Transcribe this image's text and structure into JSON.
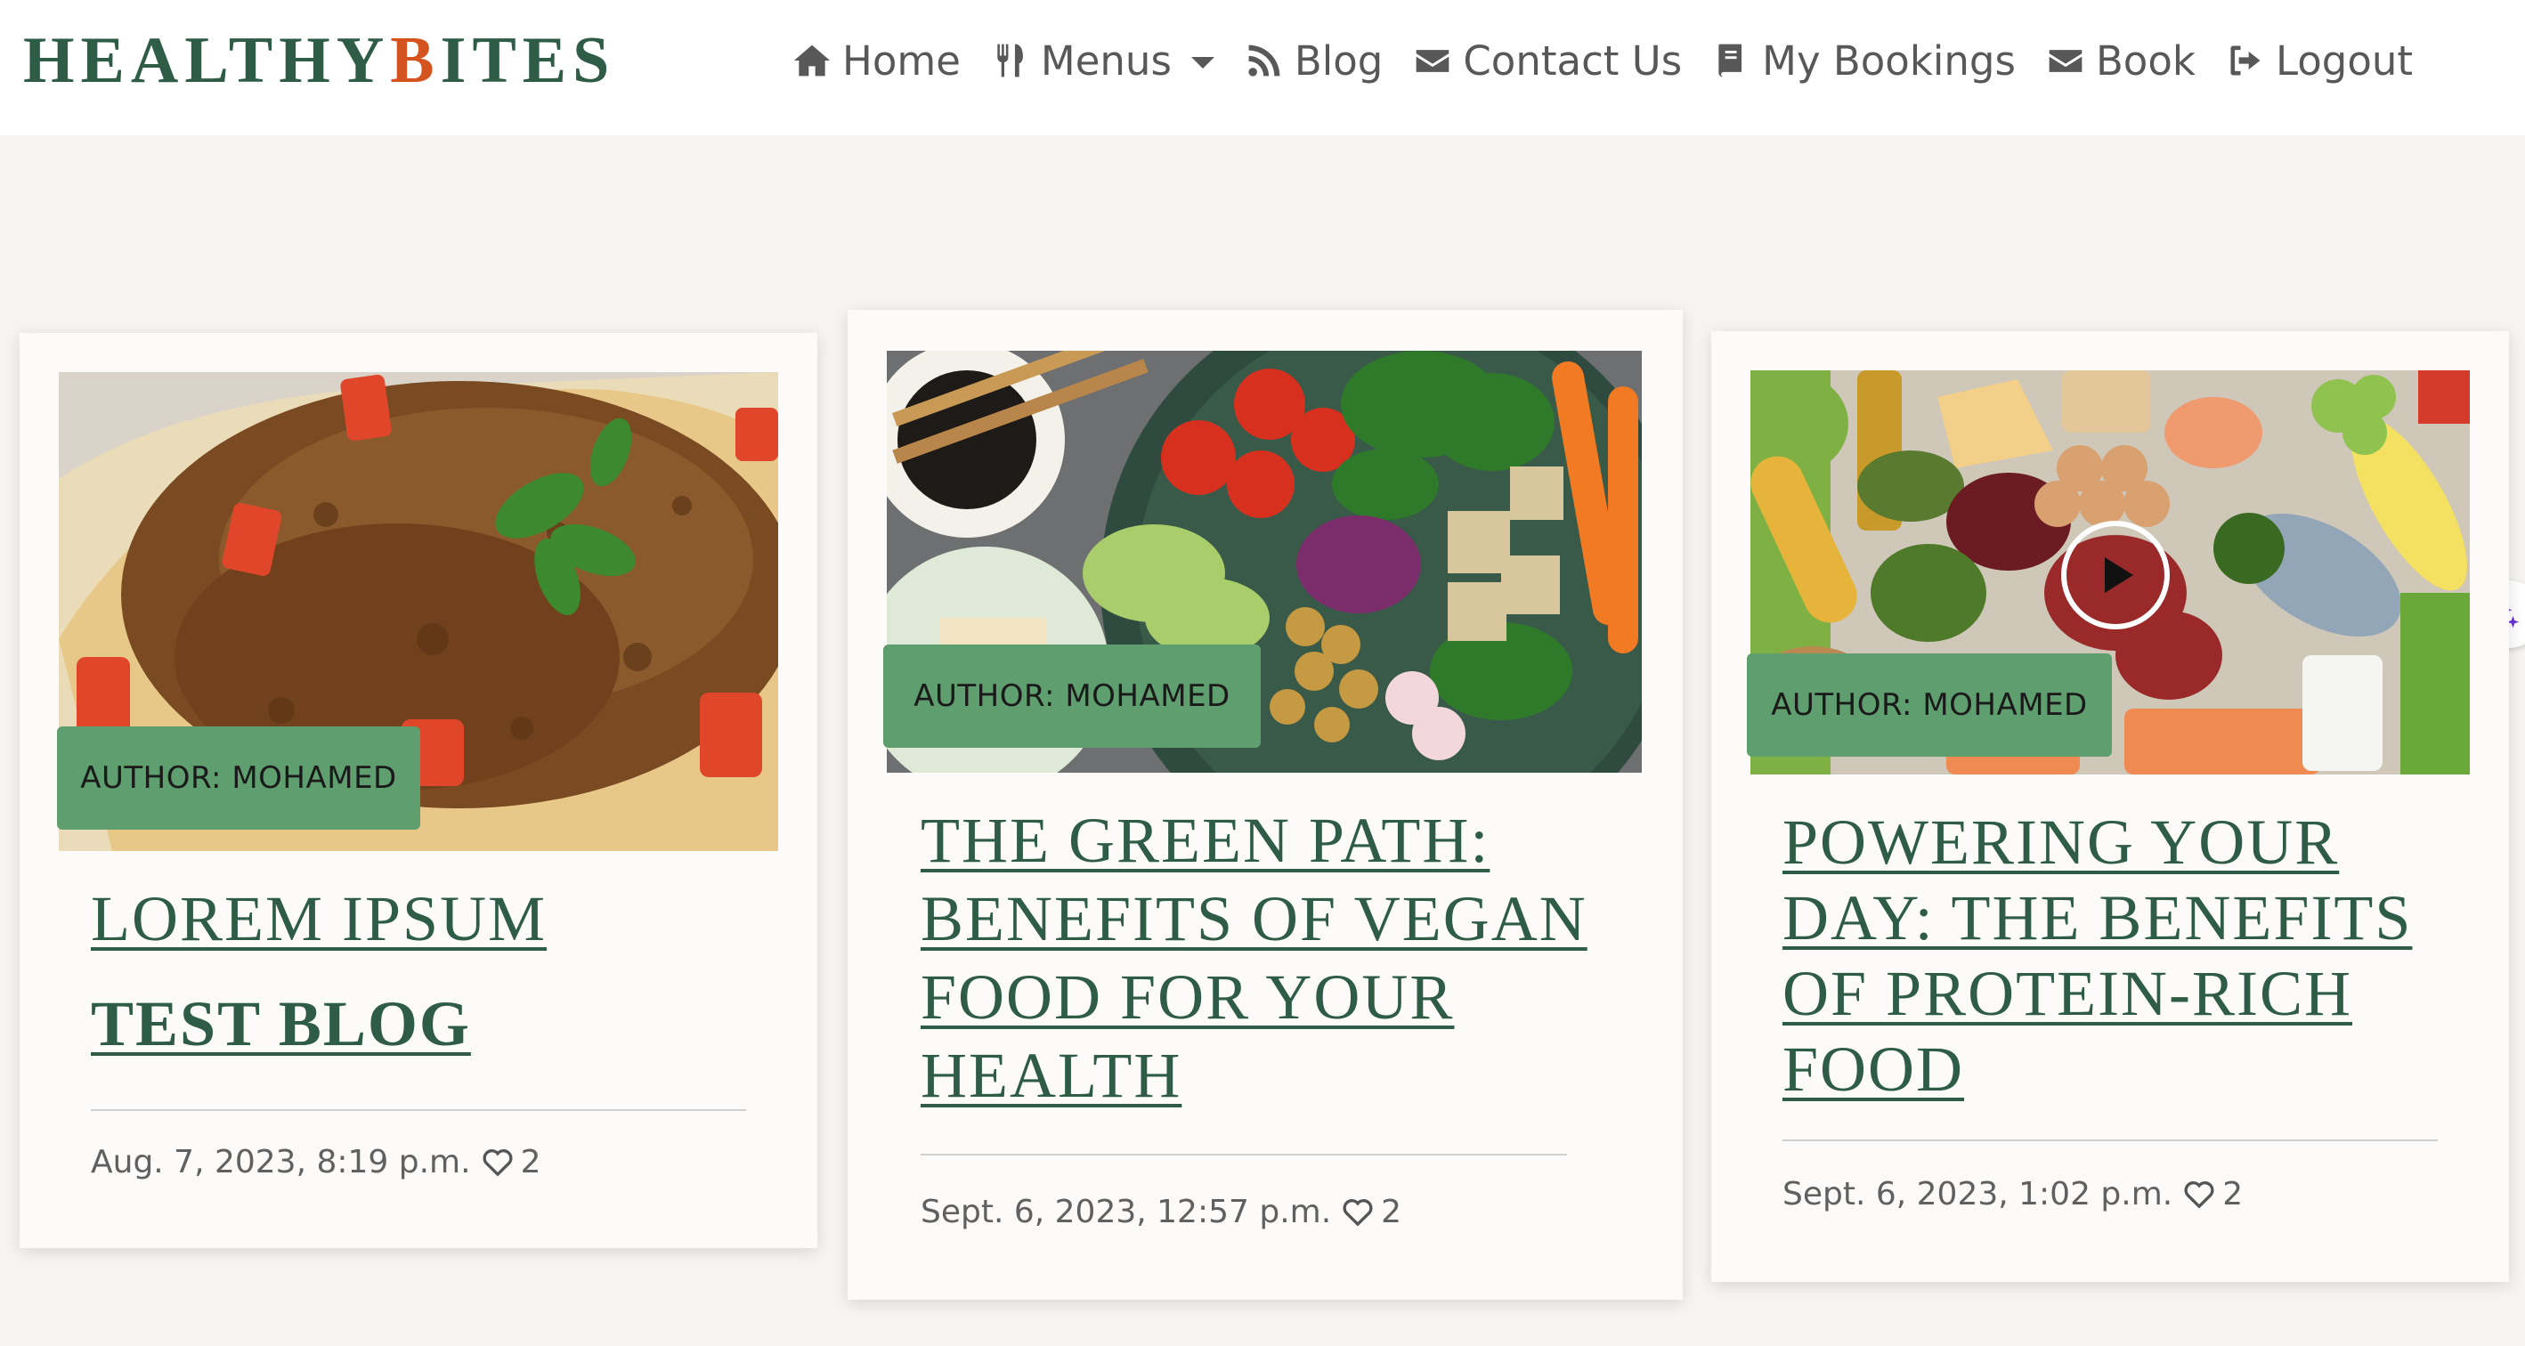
{
  "brand": {
    "part1": "HEALTHY",
    "part2": "B",
    "part3": "ITES"
  },
  "nav": {
    "home": "Home",
    "menus": "Menus",
    "blog": "Blog",
    "contact": "Contact Us",
    "bookings": "My Bookings",
    "book": "Book",
    "logout": "Logout"
  },
  "icons": {
    "home": "home-icon",
    "menus": "utensils-icon",
    "blog": "rss-icon",
    "contact": "envelope-icon",
    "bookings": "book-icon",
    "book": "envelope-icon",
    "logout": "sign-out-icon",
    "like": "heart-icon",
    "assistant": "sparkle-icon"
  },
  "colors": {
    "brand_green": "#2f5c47",
    "brand_orange": "#d4531f",
    "badge_green": "#5f9e6e"
  },
  "posts": [
    {
      "author": "AUTHOR: MOHAMED",
      "title_line1": "LOREM IPSUM",
      "title_line2": "TEST BLOG",
      "date": "Aug. 7, 2023, 8:19 p.m.",
      "likes": "2"
    },
    {
      "author": "AUTHOR: MOHAMED",
      "title": "THE GREEN PATH: BENEFITS OF VEGAN FOOD FOR YOUR HEALTH",
      "date": "Sept. 6, 2023, 12:57 p.m.",
      "likes": "2"
    },
    {
      "author": "AUTHOR: MOHAMED",
      "title": "POWERING YOUR DAY: THE BENEFITS OF PROTEIN-RICH FOOD",
      "date": "Sept. 6, 2023, 1:02 p.m.",
      "likes": "2"
    }
  ]
}
